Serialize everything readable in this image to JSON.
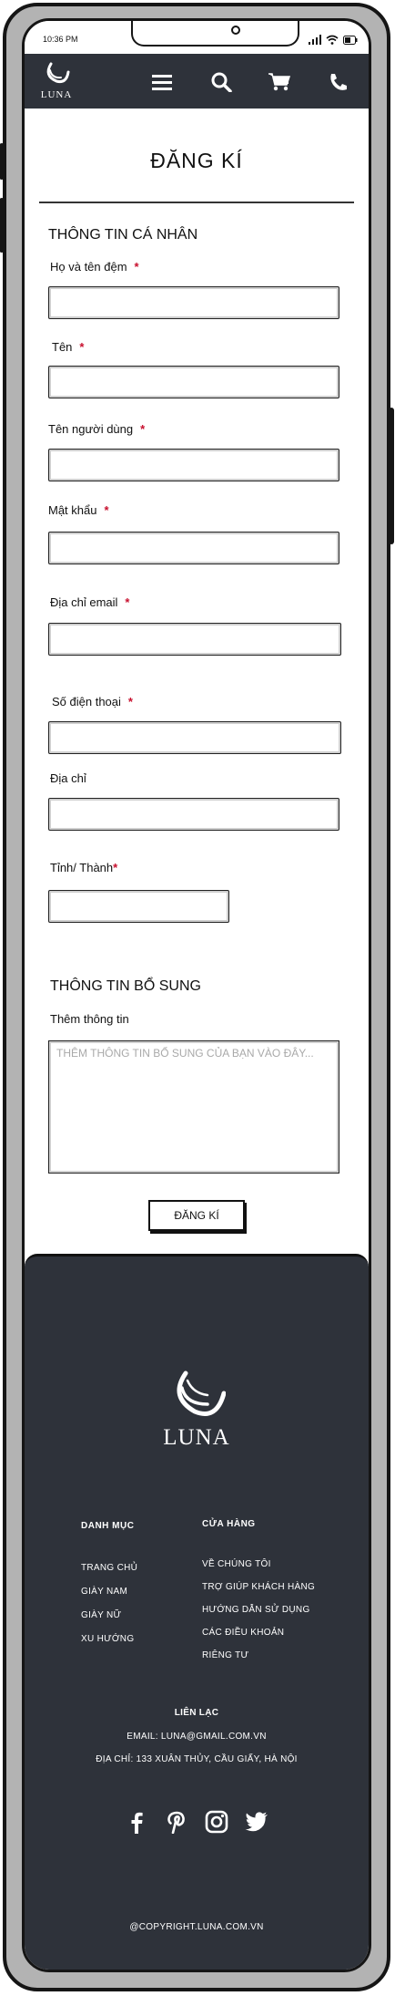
{
  "status_bar": {
    "time": "10:36 PM"
  },
  "nav": {
    "logo_text": "LUNA"
  },
  "page": {
    "title": "ĐĂNG KÍ"
  },
  "personal_section": {
    "heading": "THÔNG TIN CÁ NHÂN",
    "fields": [
      {
        "label": "Họ và tên đệm",
        "required": "*"
      },
      {
        "label": "Tên",
        "required": "*"
      },
      {
        "label": "Tên người dùng",
        "required": "*"
      },
      {
        "label": "Mật khẩu",
        "required": "*"
      },
      {
        "label": "Địa chỉ email",
        "required": "*"
      },
      {
        "label": "Số điện thoại",
        "required": "*"
      },
      {
        "label": "Địa chỉ"
      },
      {
        "label": "Tỉnh/ Thành",
        "required": "*"
      }
    ]
  },
  "extra_section": {
    "heading": "THÔNG TIN BỔ SUNG",
    "label": "Thêm thông tin",
    "placeholder": "THÊM THÔNG TIN BỔ SUNG CỦA BẠN VÀO ĐÂY..."
  },
  "submit_label": "ĐĂNG KÍ",
  "footer": {
    "logo_text": "LUNA",
    "categories": {
      "heading": "DANH MỤC",
      "items": [
        "TRANG CHỦ",
        "GIÀY NAM",
        "GIÀY NỮ",
        "XU HƯỚNG"
      ]
    },
    "store": {
      "heading": "CỬA HÀNG",
      "items": [
        "VỀ CHÚNG TÔI",
        "TRỢ GIÚP KHÁCH HÀNG",
        "HƯỚNG DẪN SỬ DỤNG",
        "CÁC ĐIỀU KHOẢN",
        "RIÊNG TƯ"
      ]
    },
    "contact": {
      "heading": "LIÊN LẠC",
      "email": "EMAIL: LUNA@GMAIL.COM.VN",
      "address": "ĐỊA CHỈ: 133 XUÂN THỦY, CẦU GIẤY, HÀ NỘI"
    },
    "copyright": "@COPYRIGHT.LUNA.COM.VN"
  },
  "colors": {
    "nav_bg": "#2e323a",
    "required": "#c8102e"
  },
  "icons": [
    "menu-icon",
    "search-icon",
    "cart-icon",
    "phone-icon",
    "facebook-icon",
    "pinterest-icon",
    "instagram-icon",
    "twitter-icon"
  ]
}
